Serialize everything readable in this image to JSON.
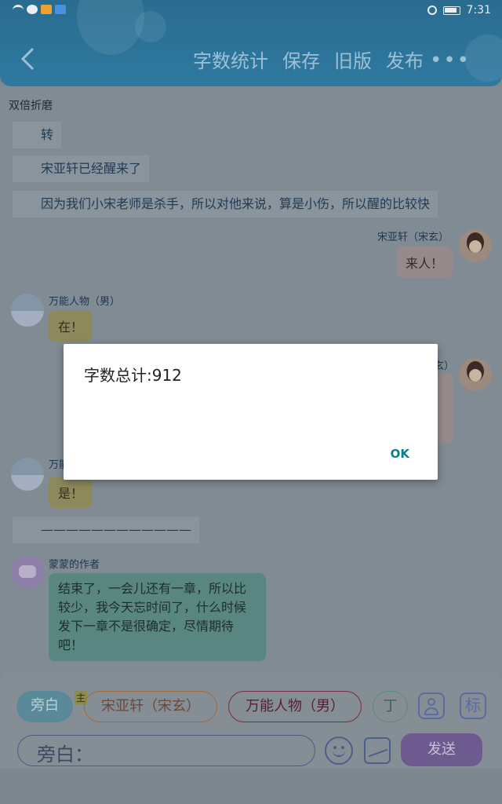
{
  "status_bar": {
    "time": "7:31"
  },
  "header": {
    "toolbar": [
      "字数统计",
      "保存",
      "旧版",
      "发布"
    ],
    "more": "•••"
  },
  "page_title": "双倍折磨",
  "narration": [
    "转",
    "宋亚轩已经醒来了",
    "因为我们小宋老师是杀手，所以对他来说，算是小伤，所以醒的比较快"
  ],
  "messages": [
    {
      "name": "宋亚轩（宋玄）",
      "text": "来人！"
    },
    {
      "name": "万能人物（男）",
      "text": "在！"
    },
    {
      "name": "玄）",
      "text": ""
    },
    {
      "name": "万能",
      "text": "是！"
    }
  ],
  "divider": "————————————",
  "author": {
    "name": "蒙蒙的作者",
    "text": "结束了，一会儿还有一章，所以比较少，我今天忘时间了，什么时候发下一章不是很确定，尽情期待吧！"
  },
  "chips": [
    "旁白",
    "宋亚轩（宋玄）",
    "万能人物（男）",
    "丁"
  ],
  "chip_badge": "主",
  "biao": "标",
  "input": {
    "value": "旁白："
  },
  "send_label": "发送",
  "dialog": {
    "text": "字数总计:912",
    "ok_label": "OK"
  }
}
